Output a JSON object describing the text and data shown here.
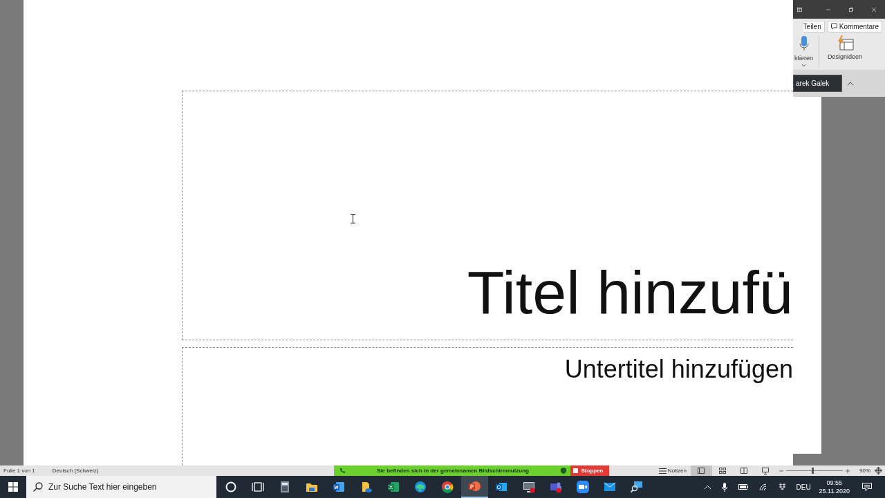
{
  "ribbon": {
    "buttons": [
      {
        "label": "Teilen",
        "kind": "share"
      },
      {
        "label": "Kommentare",
        "kind": "comments"
      }
    ],
    "groups": [
      {
        "label": "ktieren",
        "kind": "dictate"
      },
      {
        "label": "Designideen",
        "kind": "design"
      }
    ],
    "tooltip": "arek Galek"
  },
  "slide": {
    "title_placeholder": "Titel hinzufü",
    "subtitle_placeholder": "Untertitel hinzufügen"
  },
  "status_bar": {
    "slide_count": "Folie 1 von 1",
    "language": "Deutsch (Schweiz)",
    "sharing_notice": "Sie befinden sich in der gemeinsamen Bildschirmnutzung",
    "stop_button": "Stoppen",
    "notes_button": "Notizen",
    "views": [
      {
        "kind": "normal",
        "selected": true
      },
      {
        "kind": "sorter",
        "selected": false
      },
      {
        "kind": "reading",
        "selected": false
      },
      {
        "kind": "presenter",
        "selected": false
      }
    ],
    "zoom": {
      "level": 0.45,
      "reading": "90%"
    }
  },
  "taskbar": {
    "search_placeholder": "Zur Suche Text hier eingeben",
    "apps": [
      {
        "kind": "cortana",
        "selected": false
      },
      {
        "kind": "taskview",
        "selected": false
      },
      {
        "kind": "calculator",
        "selected": false
      },
      {
        "kind": "explorer",
        "selected": false
      },
      {
        "kind": "word",
        "selected": false
      },
      {
        "kind": "onedrive",
        "selected": false
      },
      {
        "kind": "excel",
        "selected": false
      },
      {
        "kind": "edge",
        "selected": false
      },
      {
        "kind": "chrome",
        "selected": false
      },
      {
        "kind": "powerpoint",
        "selected": true
      },
      {
        "kind": "outlook",
        "selected": false
      },
      {
        "kind": "remote",
        "selected": false
      },
      {
        "kind": "teams",
        "selected": false
      },
      {
        "kind": "zoom",
        "selected": false
      },
      {
        "kind": "mail",
        "selected": false
      },
      {
        "kind": "magnifier",
        "selected": false
      }
    ],
    "language": "DEU",
    "time": "09:55",
    "date": "25.11.2020"
  }
}
